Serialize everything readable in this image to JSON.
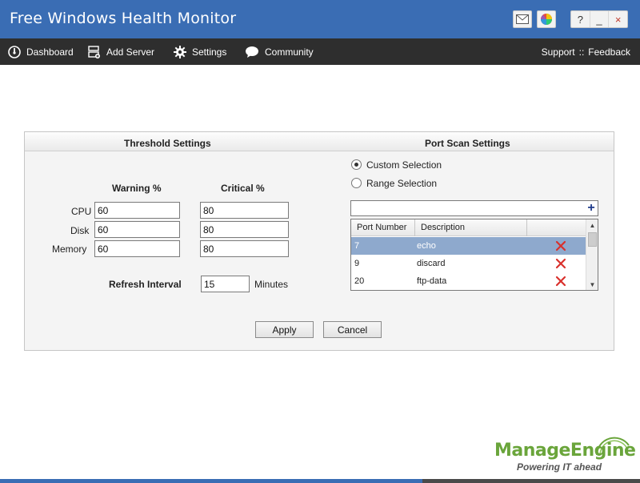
{
  "app": {
    "title": "Free Windows Health Monitor"
  },
  "titlebar": {
    "help_label": "?",
    "minimize_label": "_",
    "close_label": "×",
    "mail_icon": "mail-icon",
    "theme_icon": "color-palette-icon"
  },
  "nav": {
    "items": [
      {
        "label": "Dashboard",
        "icon": "dashboard-icon"
      },
      {
        "label": "Add Server",
        "icon": "server-icon"
      },
      {
        "label": "Settings",
        "icon": "gear-icon"
      },
      {
        "label": "Community",
        "icon": "chat-bubble-icon"
      }
    ],
    "support_label": "Support",
    "separator": "::",
    "feedback_label": "Feedback"
  },
  "threshold": {
    "title": "Threshold Settings",
    "warning_header": "Warning %",
    "critical_header": "Critical %",
    "rows": [
      {
        "label": "CPU",
        "warning": "60",
        "critical": "80"
      },
      {
        "label": "Disk",
        "warning": "60",
        "critical": "80"
      },
      {
        "label": "Memory",
        "warning": "60",
        "critical": "80"
      }
    ],
    "refresh_label": "Refresh Interval",
    "refresh_value": "15",
    "refresh_unit": "Minutes"
  },
  "portscan": {
    "title": "Port Scan Settings",
    "options": [
      {
        "label": "Custom Selection",
        "checked": true
      },
      {
        "label": "Range Selection",
        "checked": false
      }
    ],
    "port_input_value": "",
    "add_label": "+",
    "columns": [
      "Port Number",
      "Description"
    ],
    "rows": [
      {
        "port": "7",
        "description": "echo",
        "selected": true
      },
      {
        "port": "9",
        "description": "discard",
        "selected": false
      },
      {
        "port": "20",
        "description": "ftp-data",
        "selected": false
      }
    ]
  },
  "buttons": {
    "apply": "Apply",
    "cancel": "Cancel"
  },
  "logo": {
    "name": "ManageEngine",
    "tagline": "Powering IT ahead"
  },
  "colors": {
    "titlebar": "#3a6db4",
    "navbar": "#2e2e2e",
    "brand_green": "#6aa53b",
    "selected_row": "#8ea9cd",
    "delete_red": "#d9302c"
  }
}
